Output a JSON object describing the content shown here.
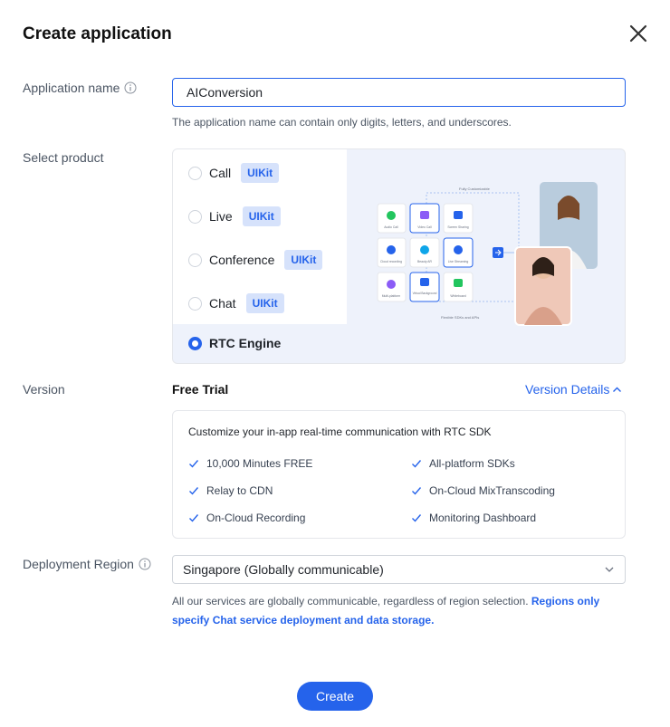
{
  "dialog": {
    "title": "Create application"
  },
  "app_name": {
    "label": "Application name",
    "value": "AIConversion",
    "hint": "The application name can contain only digits, letters, and underscores."
  },
  "product": {
    "label": "Select product",
    "options": [
      {
        "name": "Call",
        "badge": "UIKit",
        "selected": false
      },
      {
        "name": "Live",
        "badge": "UIKit",
        "selected": false
      },
      {
        "name": "Conference",
        "badge": "UIKit",
        "selected": false
      },
      {
        "name": "Chat",
        "badge": "UIKit",
        "selected": false
      },
      {
        "name": "RTC Engine",
        "badge": "",
        "selected": true
      }
    ],
    "illustration": {
      "top_caption": "Fully Customizable",
      "bottom_caption": "Flexible SDKs and APIs",
      "tiles": [
        "Audio Call",
        "Video Call",
        "Screen Sharing",
        "Cloud recording",
        "Beauty AR",
        "Live Streaming",
        "Multi-platform",
        "Virtual Background",
        "Whiteboard"
      ]
    }
  },
  "version": {
    "label": "Version",
    "plan": "Free Trial",
    "details_link": "Version Details",
    "box_title": "Customize your in-app real-time communication with RTC SDK",
    "features_left": [
      "10,000 Minutes FREE",
      "Relay to CDN",
      "On-Cloud Recording"
    ],
    "features_right": [
      "All-platform SDKs",
      "On-Cloud MixTranscoding",
      "Monitoring Dashboard"
    ]
  },
  "region": {
    "label": "Deployment Region",
    "value": "Singapore (Globally communicable)",
    "note": "All our services are globally communicable, regardless of region selection. ",
    "note_bold": "Regions only specify Chat service deployment and data storage."
  },
  "actions": {
    "create_label": "Create"
  },
  "colors": {
    "accent": "#2563eb",
    "badge_bg": "#d6e2fb",
    "panel_bg": "#eef2fb"
  }
}
